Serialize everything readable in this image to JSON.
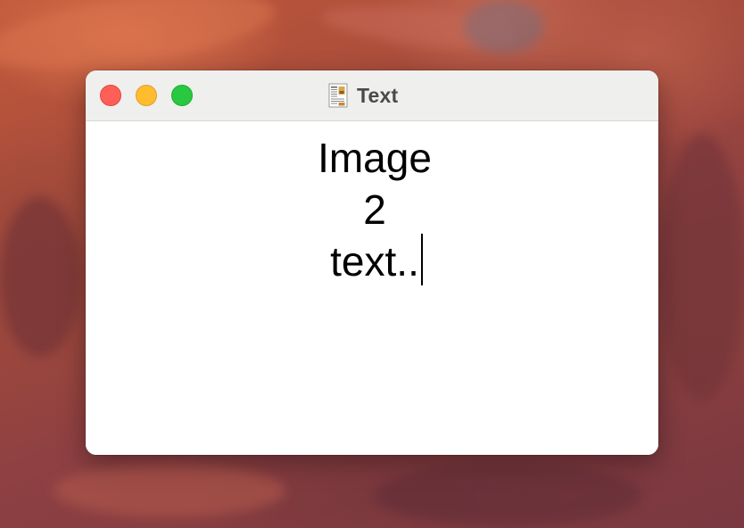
{
  "window": {
    "title": "Text",
    "title_icon": "text-document-icon"
  },
  "traffic_lights": {
    "close": "#fe5f57",
    "minimize": "#febc2e",
    "zoom": "#28c840"
  },
  "document": {
    "lines": [
      "Image",
      "2",
      "text.."
    ]
  }
}
